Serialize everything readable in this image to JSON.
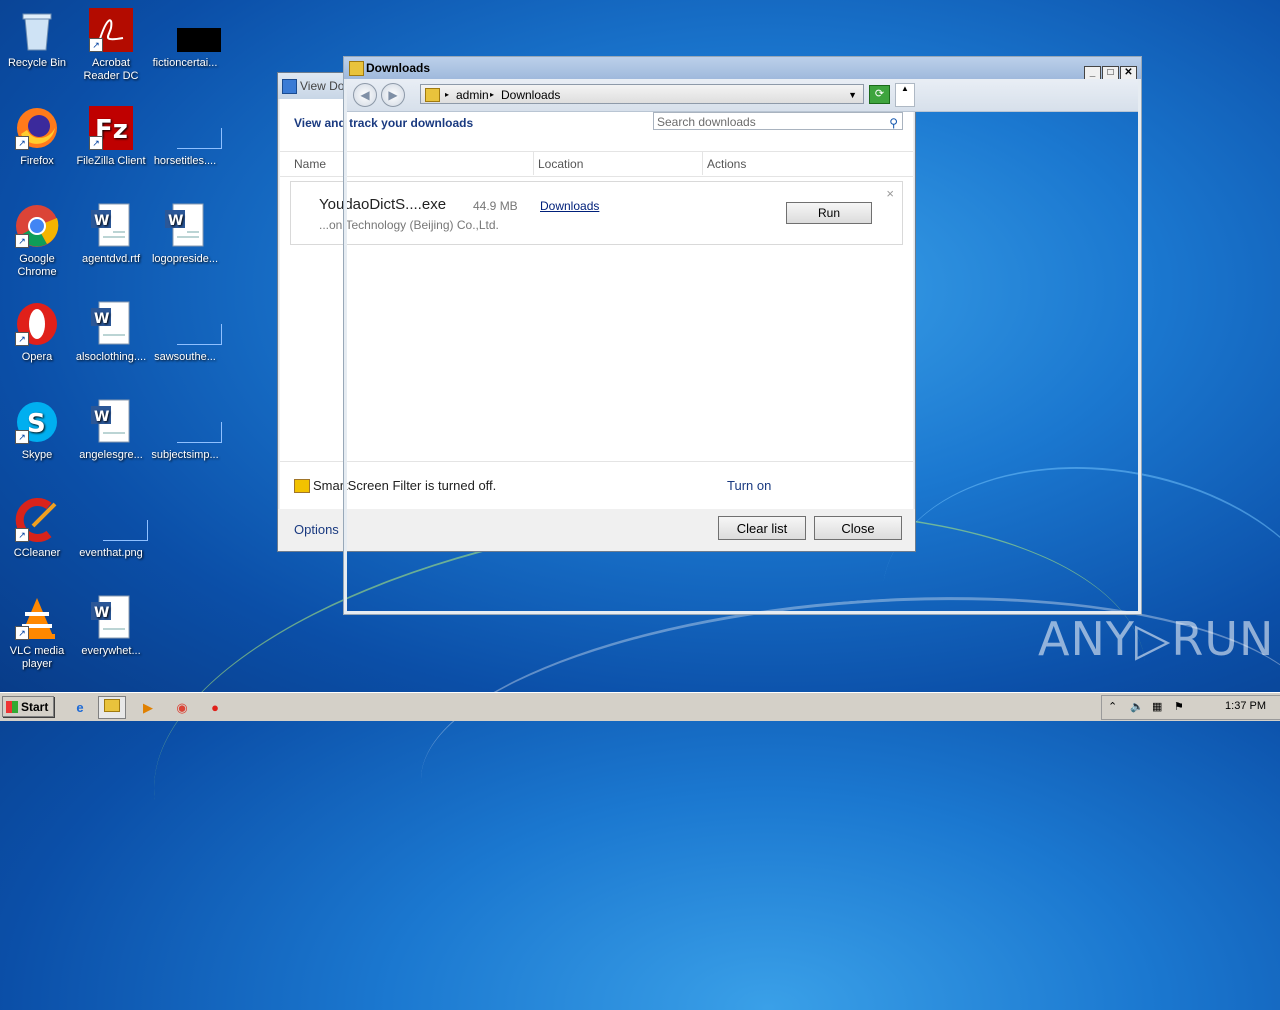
{
  "desktop": {
    "icons": [
      {
        "label": "Recycle Bin"
      },
      {
        "label": "Acrobat\nReader DC"
      },
      {
        "label": "fictioncertai..."
      },
      {
        "label": "Firefox"
      },
      {
        "label": "FileZilla Client"
      },
      {
        "label": "horsetitles...."
      },
      {
        "label": "Google\nChrome"
      },
      {
        "label": "agentdvd.rtf"
      },
      {
        "label": "logopreside..."
      },
      {
        "label": "Opera"
      },
      {
        "label": "alsoclothing...."
      },
      {
        "label": "sawsouthe..."
      },
      {
        "label": "Skype"
      },
      {
        "label": "angelesgre..."
      },
      {
        "label": "subjectsimp..."
      },
      {
        "label": "CCleaner"
      },
      {
        "label": "eventhat.png"
      },
      {
        "label": "VLC media\nplayer"
      },
      {
        "label": "everywhet..."
      }
    ]
  },
  "view_downloads": {
    "title": "View Do",
    "header": "View and track your downloads",
    "search_placeholder": "Search downloads",
    "columns": {
      "name": "Name",
      "location": "Location",
      "actions": "Actions"
    },
    "item": {
      "filename": "YoudaoDictS....exe",
      "size": "44.9 MB",
      "publisher": "...on Technology (Beijing) Co.,Ltd.",
      "location": "Downloads",
      "action": "Run"
    },
    "smartscreen_text": "SmartScreen Filter is turned off.",
    "turn_on": "Turn on",
    "options": "Options",
    "clear_list": "Clear list",
    "close": "Close"
  },
  "explorer": {
    "title": "Downloads",
    "breadcrumb": [
      "admin",
      "Downloads"
    ]
  },
  "taskbar": {
    "start": "Start",
    "clock": "1:37 PM"
  },
  "watermark": "ANY▷RUN"
}
